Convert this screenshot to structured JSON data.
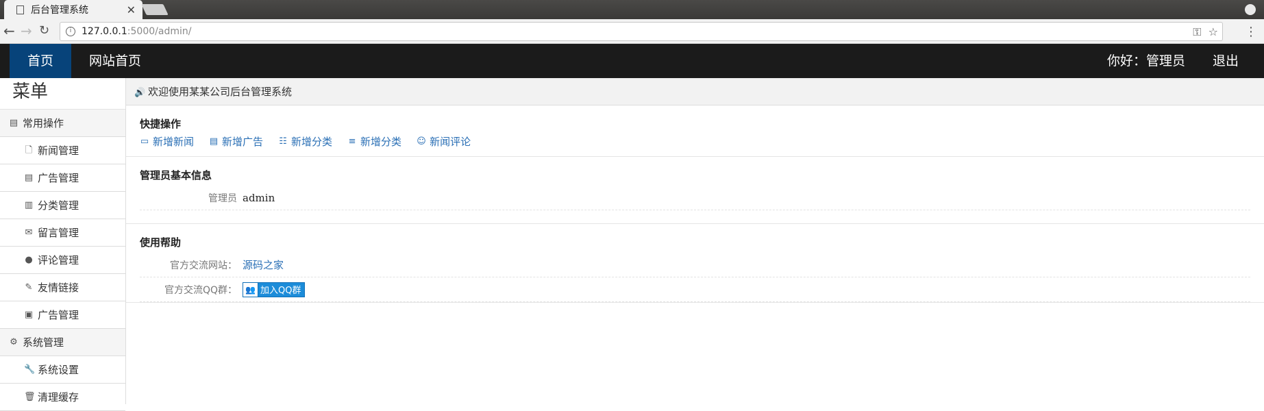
{
  "browser": {
    "tab_title": "后台管理系统",
    "url_host": "127.0.0.1",
    "url_path": ":5000/admin/"
  },
  "topnav": {
    "home": "首页",
    "site_home": "网站首页",
    "greeting": "你好：管理员",
    "logout": "退出"
  },
  "sidebar": {
    "title": "菜单",
    "groups": [
      {
        "label": "常用操作",
        "icon": "book-icon"
      },
      {
        "label": "系统管理",
        "icon": "gear-icon"
      }
    ],
    "items": [
      {
        "label": "新闻管理",
        "icon": "file-icon"
      },
      {
        "label": "广告管理",
        "icon": "list-alt-icon"
      },
      {
        "label": "分类管理",
        "icon": "books-icon"
      },
      {
        "label": "留言管理",
        "icon": "envelope-icon"
      },
      {
        "label": "评论管理",
        "icon": "comment-icon"
      },
      {
        "label": "友情链接",
        "icon": "link-icon"
      },
      {
        "label": "广告管理",
        "icon": "picture-icon"
      },
      {
        "label": "系统设置",
        "icon": "wrench-icon"
      },
      {
        "label": "清理缓存",
        "icon": "trash-icon"
      }
    ]
  },
  "main": {
    "welcome": "欢迎使用某某公司后台管理系统",
    "quick": {
      "title": "快捷操作",
      "links": [
        {
          "label": "新增新闻",
          "icon": "newspaper-icon"
        },
        {
          "label": "新增广告",
          "icon": "document-icon"
        },
        {
          "label": "新增分类",
          "icon": "list-icon"
        },
        {
          "label": "新增分类",
          "icon": "align-justify-icon"
        },
        {
          "label": "新闻评论",
          "icon": "smile-icon"
        }
      ]
    },
    "admin_info": {
      "title": "管理员基本信息",
      "label": "管理员",
      "value": "admin"
    },
    "help": {
      "title": "使用帮助",
      "site_label": "官方交流网站：",
      "site_value": "源码之家",
      "qq_label": "官方交流QQ群：",
      "qq_button": "加入QQ群"
    }
  }
}
